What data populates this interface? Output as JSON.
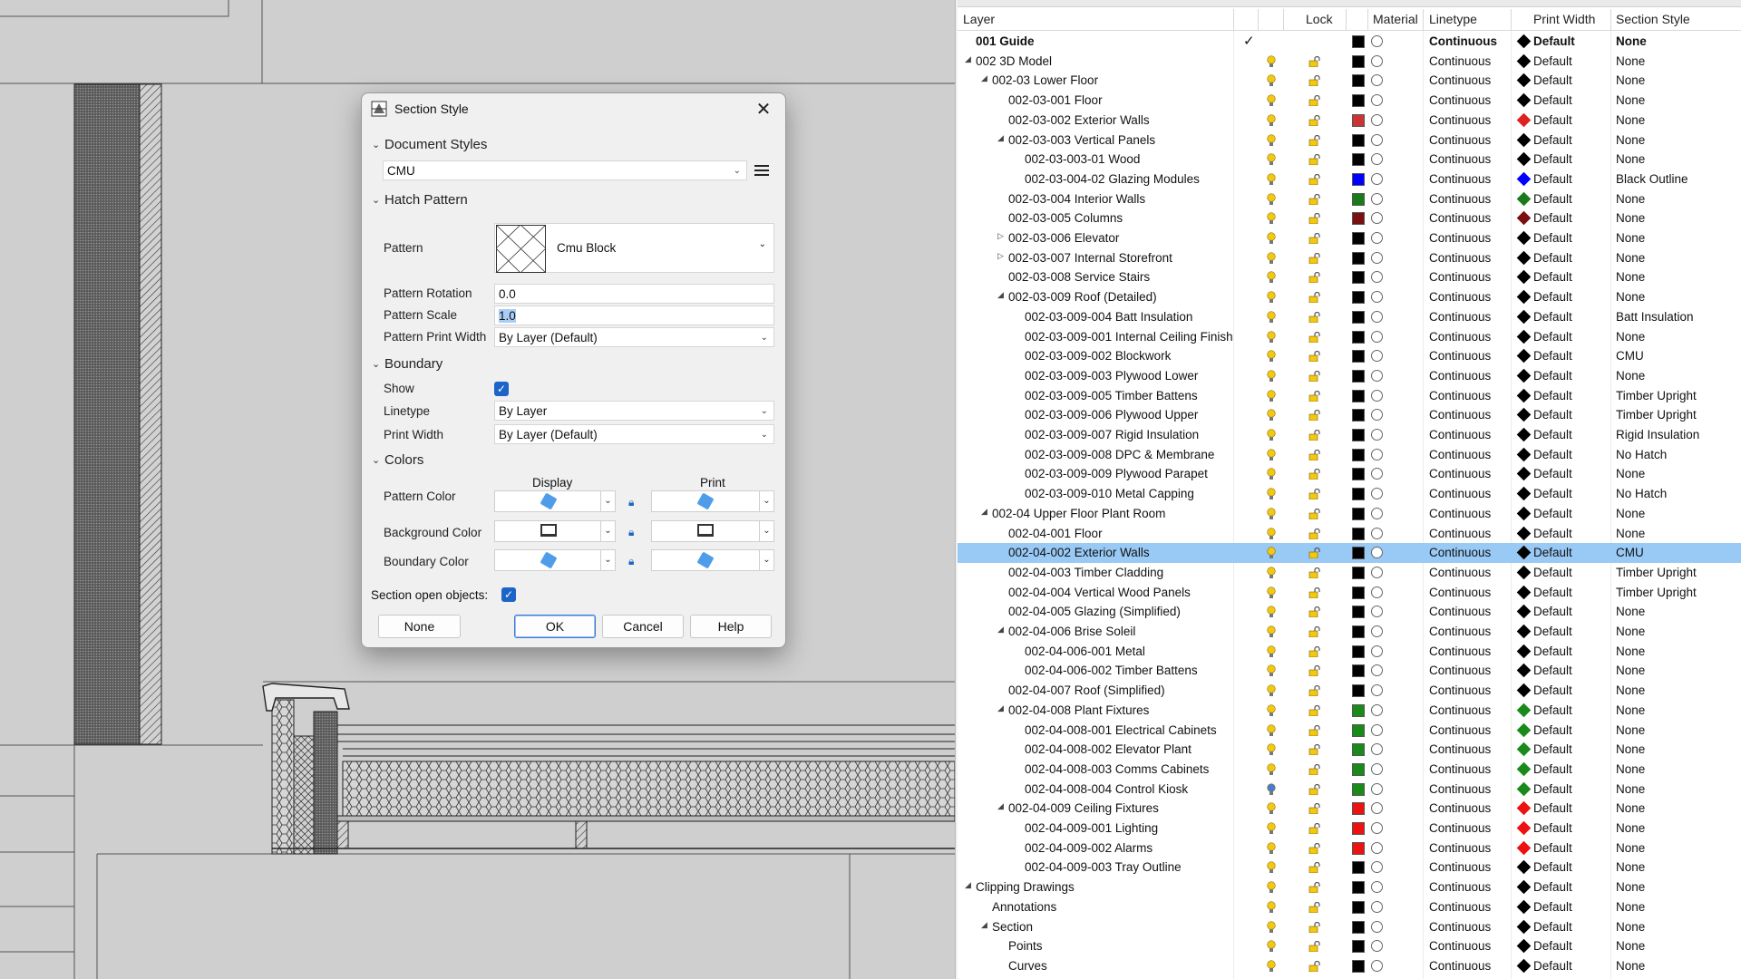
{
  "dialog": {
    "title": "Section Style",
    "sections": {
      "document_styles": "Document Styles",
      "hatch_pattern": "Hatch Pattern",
      "boundary": "Boundary",
      "colors": "Colors"
    },
    "document_style_value": "CMU",
    "pattern_label": "Pattern",
    "pattern_value": "Cmu Block",
    "pattern_rotation_label": "Pattern Rotation",
    "pattern_rotation_value": "0.0",
    "pattern_scale_label": "Pattern Scale",
    "pattern_scale_value": "1.0",
    "pattern_print_width_label": "Pattern Print Width",
    "pattern_print_width_value": "By Layer (Default)",
    "show_label": "Show",
    "show_checked": true,
    "linetype_label": "Linetype",
    "linetype_value": "By Layer",
    "print_width_label": "Print Width",
    "print_width_value": "By Layer (Default)",
    "display_label": "Display",
    "print_label": "Print",
    "pattern_color_label": "Pattern Color",
    "background_color_label": "Background Color",
    "boundary_color_label": "Boundary Color",
    "section_open_objects_label": "Section open objects:",
    "section_open_objects_checked": true,
    "buttons": {
      "none": "None",
      "ok": "OK",
      "cancel": "Cancel",
      "help": "Help"
    }
  },
  "layers_panel": {
    "headers": {
      "layer": "Layer",
      "lock": "Lock",
      "material": "Material",
      "linetype": "Linetype",
      "print_width": "Print Width",
      "section_style": "Section Style"
    },
    "rows": [
      {
        "name": "001 Guide",
        "indent": 0,
        "tw": "",
        "current": true,
        "bold": true,
        "color": "#000000",
        "linetype": "Continuous",
        "print_width": "Default",
        "section_style": "None"
      },
      {
        "name": "002 3D Model",
        "indent": 0,
        "tw": "open",
        "color": "#000000",
        "linetype": "Continuous",
        "print_width": "Default",
        "section_style": "None"
      },
      {
        "name": "002-03 Lower Floor",
        "indent": 1,
        "tw": "open",
        "color": "#000000",
        "linetype": "Continuous",
        "print_width": "Default",
        "section_style": "None"
      },
      {
        "name": "002-03-001 Floor",
        "indent": 2,
        "tw": "",
        "color": "#000000",
        "linetype": "Continuous",
        "print_width": "Default",
        "section_style": "None"
      },
      {
        "name": "002-03-002 Exterior Walls",
        "indent": 2,
        "tw": "",
        "color": "#cc3333",
        "linetype": "Continuous",
        "print_width": "Default",
        "section_style": "None"
      },
      {
        "name": "002-03-003 Vertical Panels",
        "indent": 2,
        "tw": "open",
        "color": "#000000",
        "linetype": "Continuous",
        "print_width": "Default",
        "section_style": "None"
      },
      {
        "name": "002-03-003-01 Wood",
        "indent": 3,
        "tw": "",
        "color": "#000000",
        "linetype": "Continuous",
        "print_width": "Default",
        "section_style": "None"
      },
      {
        "name": "002-03-004-02 Glazing Modules",
        "indent": 3,
        "tw": "",
        "color": "#0000ff",
        "linetype": "Continuous",
        "print_width": "Default",
        "section_style": "Black Outline"
      },
      {
        "name": "002-03-004 Interior Walls",
        "indent": 2,
        "tw": "",
        "color": "#1a7a1a",
        "linetype": "Continuous",
        "print_width": "Default",
        "section_style": "None"
      },
      {
        "name": "002-03-005 Columns",
        "indent": 2,
        "tw": "",
        "color": "#7a1010",
        "linetype": "Continuous",
        "print_width": "Default",
        "section_style": "None"
      },
      {
        "name": "002-03-006 Elevator",
        "indent": 2,
        "tw": "closed",
        "color": "#000000",
        "linetype": "Continuous",
        "print_width": "Default",
        "section_style": "None"
      },
      {
        "name": "002-03-007 Internal Storefront",
        "indent": 2,
        "tw": "closed",
        "color": "#000000",
        "linetype": "Continuous",
        "print_width": "Default",
        "section_style": "None"
      },
      {
        "name": "002-03-008 Service Stairs",
        "indent": 2,
        "tw": "",
        "color": "#000000",
        "linetype": "Continuous",
        "print_width": "Default",
        "section_style": "None"
      },
      {
        "name": "002-03-009 Roof (Detailed)",
        "indent": 2,
        "tw": "open",
        "color": "#000000",
        "linetype": "Continuous",
        "print_width": "Default",
        "section_style": "None"
      },
      {
        "name": "002-03-009-004 Batt Insulation",
        "indent": 3,
        "tw": "",
        "color": "#000000",
        "linetype": "Continuous",
        "print_width": "Default",
        "section_style": "Batt Insulation"
      },
      {
        "name": "002-03-009-001 Internal Ceiling Finish",
        "indent": 3,
        "tw": "",
        "color": "#000000",
        "linetype": "Continuous",
        "print_width": "Default",
        "section_style": "None"
      },
      {
        "name": "002-03-009-002 Blockwork",
        "indent": 3,
        "tw": "",
        "color": "#000000",
        "linetype": "Continuous",
        "print_width": "Default",
        "section_style": "CMU"
      },
      {
        "name": "002-03-009-003 Plywood Lower",
        "indent": 3,
        "tw": "",
        "color": "#000000",
        "linetype": "Continuous",
        "print_width": "Default",
        "section_style": "None"
      },
      {
        "name": "002-03-009-005 Timber Battens",
        "indent": 3,
        "tw": "",
        "color": "#000000",
        "linetype": "Continuous",
        "print_width": "Default",
        "section_style": "Timber Upright"
      },
      {
        "name": "002-03-009-006 Plywood Upper",
        "indent": 3,
        "tw": "",
        "color": "#000000",
        "linetype": "Continuous",
        "print_width": "Default",
        "section_style": "Timber Upright"
      },
      {
        "name": "002-03-009-007 Rigid Insulation",
        "indent": 3,
        "tw": "",
        "color": "#000000",
        "linetype": "Continuous",
        "print_width": "Default",
        "section_style": "Rigid Insulation"
      },
      {
        "name": "002-03-009-008 DPC & Membrane",
        "indent": 3,
        "tw": "",
        "color": "#000000",
        "linetype": "Continuous",
        "print_width": "Default",
        "section_style": "No Hatch"
      },
      {
        "name": "002-03-009-009 Plywood Parapet",
        "indent": 3,
        "tw": "",
        "color": "#000000",
        "linetype": "Continuous",
        "print_width": "Default",
        "section_style": "None"
      },
      {
        "name": "002-03-009-010 Metal Capping",
        "indent": 3,
        "tw": "",
        "color": "#000000",
        "linetype": "Continuous",
        "print_width": "Default",
        "section_style": "No Hatch"
      },
      {
        "name": "002-04 Upper Floor Plant Room",
        "indent": 1,
        "tw": "open",
        "color": "#000000",
        "linetype": "Continuous",
        "print_width": "Default",
        "section_style": "None"
      },
      {
        "name": "002-04-001 Floor",
        "indent": 2,
        "tw": "",
        "color": "#000000",
        "linetype": "Continuous",
        "print_width": "Default",
        "section_style": "None"
      },
      {
        "name": "002-04-002 Exterior Walls",
        "indent": 2,
        "tw": "",
        "selected": true,
        "color": "#000000",
        "linetype": "Continuous",
        "print_width": "Default",
        "section_style": "CMU"
      },
      {
        "name": "002-04-003 Timber Cladding",
        "indent": 2,
        "tw": "",
        "color": "#000000",
        "linetype": "Continuous",
        "print_width": "Default",
        "section_style": "Timber Upright"
      },
      {
        "name": "002-04-004 Vertical Wood Panels",
        "indent": 2,
        "tw": "",
        "color": "#000000",
        "linetype": "Continuous",
        "print_width": "Default",
        "section_style": "Timber Upright"
      },
      {
        "name": "002-04-005 Glazing (Simplified)",
        "indent": 2,
        "tw": "",
        "color": "#000000",
        "linetype": "Continuous",
        "print_width": "Default",
        "section_style": "None"
      },
      {
        "name": "002-04-006 Brise Soleil",
        "indent": 2,
        "tw": "open",
        "color": "#000000",
        "linetype": "Continuous",
        "print_width": "Default",
        "section_style": "None"
      },
      {
        "name": "002-04-006-001 Metal",
        "indent": 3,
        "tw": "",
        "color": "#000000",
        "linetype": "Continuous",
        "print_width": "Default",
        "section_style": "None"
      },
      {
        "name": "002-04-006-002 Timber Battens",
        "indent": 3,
        "tw": "",
        "color": "#000000",
        "linetype": "Continuous",
        "print_width": "Default",
        "section_style": "None"
      },
      {
        "name": "002-04-007 Roof (Simplified)",
        "indent": 2,
        "tw": "",
        "color": "#000000",
        "linetype": "Continuous",
        "print_width": "Default",
        "section_style": "None"
      },
      {
        "name": "002-04-008 Plant Fixtures",
        "indent": 2,
        "tw": "open",
        "color": "#1a8a1a",
        "linetype": "Continuous",
        "print_width": "Default",
        "section_style": "None"
      },
      {
        "name": "002-04-008-001 Electrical Cabinets",
        "indent": 3,
        "tw": "",
        "color": "#1a8a1a",
        "linetype": "Continuous",
        "print_width": "Default",
        "section_style": "None"
      },
      {
        "name": "002-04-008-002 Elevator Plant",
        "indent": 3,
        "tw": "",
        "color": "#1a8a1a",
        "linetype": "Continuous",
        "print_width": "Default",
        "section_style": "None"
      },
      {
        "name": "002-04-008-003 Comms Cabinets",
        "indent": 3,
        "tw": "",
        "color": "#1a8a1a",
        "linetype": "Continuous",
        "print_width": "Default",
        "section_style": "None"
      },
      {
        "name": "002-04-008-004 Control Kiosk",
        "indent": 3,
        "tw": "",
        "bulb": "off",
        "color": "#1a8a1a",
        "linetype": "Continuous",
        "print_width": "Default",
        "section_style": "None"
      },
      {
        "name": "002-04-009 Ceiling Fixtures",
        "indent": 2,
        "tw": "open",
        "color": "#ee1111",
        "linetype": "Continuous",
        "print_width": "Default",
        "section_style": "None"
      },
      {
        "name": "002-04-009-001 Lighting",
        "indent": 3,
        "tw": "",
        "color": "#ee1111",
        "linetype": "Continuous",
        "print_width": "Default",
        "section_style": "None"
      },
      {
        "name": "002-04-009-002 Alarms",
        "indent": 3,
        "tw": "",
        "color": "#ee1111",
        "linetype": "Continuous",
        "print_width": "Default",
        "section_style": "None"
      },
      {
        "name": "002-04-009-003 Tray Outline",
        "indent": 3,
        "tw": "",
        "color": "#000000",
        "linetype": "Continuous",
        "print_width": "Default",
        "section_style": "None"
      },
      {
        "name": "Clipping Drawings",
        "indent": 0,
        "tw": "open",
        "color": "#000000",
        "linetype": "Continuous",
        "print_width": "Default",
        "section_style": "None"
      },
      {
        "name": "Annotations",
        "indent": 1,
        "tw": "",
        "color": "#000000",
        "linetype": "Continuous",
        "print_width": "Default",
        "section_style": "None"
      },
      {
        "name": "Section",
        "indent": 1,
        "tw": "open",
        "color": "#000000",
        "linetype": "Continuous",
        "print_width": "Default",
        "section_style": "None"
      },
      {
        "name": "Points",
        "indent": 2,
        "tw": "",
        "color": "#000000",
        "linetype": "Continuous",
        "print_width": "Default",
        "section_style": "None"
      },
      {
        "name": "Curves",
        "indent": 2,
        "tw": "",
        "color": "#000000",
        "linetype": "Continuous",
        "print_width": "Default",
        "section_style": "None"
      }
    ]
  },
  "colors": {
    "selection": "#99c9f5",
    "bulb_on": "#f2c811",
    "bulb_off": "#4a7bd0",
    "checkbox": "#1c64c8"
  }
}
